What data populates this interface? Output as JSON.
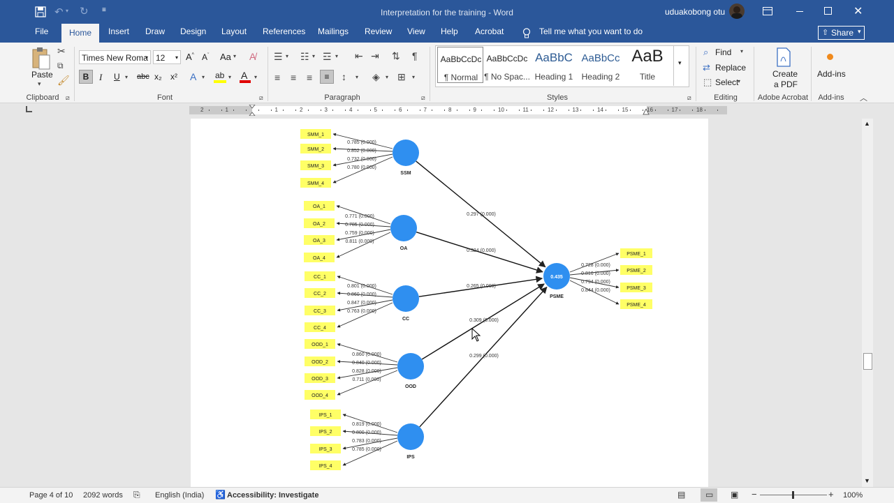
{
  "window": {
    "title": "Interpretation for the training",
    "app": "Word",
    "user": "uduakobong otu"
  },
  "tabs": [
    "File",
    "Home",
    "Insert",
    "Draw",
    "Design",
    "Layout",
    "References",
    "Mailings",
    "Review",
    "View",
    "Help",
    "Acrobat"
  ],
  "tell_me": "Tell me what you want to do",
  "share": "Share",
  "clipboard": {
    "paste": "Paste",
    "label": "Clipboard"
  },
  "font": {
    "name": "Times New Roma",
    "size": "12",
    "label": "Font",
    "bold": "B",
    "italic": "I",
    "underline": "U",
    "strike": "abc",
    "sub": "x₂",
    "sup": "x²",
    "aa": "Aa"
  },
  "paragraph": {
    "label": "Paragraph"
  },
  "styles": {
    "label": "Styles",
    "items": [
      {
        "preview": "AaBbCcDc",
        "name": "¶ Normal"
      },
      {
        "preview": "AaBbCcDc",
        "name": "¶ No Spac..."
      },
      {
        "preview": "AaBbC",
        "name": "Heading 1"
      },
      {
        "preview": "AaBbCc",
        "name": "Heading 2"
      },
      {
        "preview": "AaB",
        "name": "Title"
      }
    ]
  },
  "editing": {
    "label": "Editing",
    "find": "Find",
    "replace": "Replace",
    "select": "Select"
  },
  "acrobat": {
    "label": "Adobe Acrobat",
    "create": "Create",
    "pdf": "a PDF"
  },
  "addins": {
    "label": "Add-ins",
    "btn": "Add-ins"
  },
  "ruler": [
    "2",
    "1",
    "1",
    "2",
    "3",
    "4",
    "5",
    "6",
    "7",
    "8",
    "9",
    "10",
    "11",
    "12",
    "13",
    "14",
    "15",
    "16",
    "17",
    "18"
  ],
  "diagram": {
    "constructs": [
      {
        "name": "SSM",
        "value": ""
      },
      {
        "name": "OA",
        "value": ""
      },
      {
        "name": "CC",
        "value": ""
      },
      {
        "name": "OOD",
        "value": ""
      },
      {
        "name": "IPS",
        "value": ""
      },
      {
        "name": "PSME",
        "value": "0.435"
      }
    ],
    "indicators": [
      {
        "construct": "SSM",
        "items": [
          "SMM_1",
          "SMM_2",
          "SMM_3",
          "SMM_4"
        ],
        "loadings": [
          "0.785 (0.000)",
          "0.852 (0.000)",
          "0.732 (0.000)",
          "0.780 (0.000)"
        ]
      },
      {
        "construct": "OA",
        "items": [
          "OA_1",
          "OA_2",
          "OA_3",
          "OA_4"
        ],
        "loadings": [
          "0.771 (0.000)",
          "0.785 (0.000)",
          "0.759 (0.000)",
          "0.811 (0.000)"
        ]
      },
      {
        "construct": "CC",
        "items": [
          "CC_1",
          "CC_2",
          "CC_3",
          "CC_4"
        ],
        "loadings": [
          "0.801 (0.000)",
          "0.860 (0.000)",
          "0.847 (0.000)",
          "0.763 (0.000)"
        ]
      },
      {
        "construct": "OOD",
        "items": [
          "OOD_1",
          "OOD_2",
          "OOD_3",
          "OOD_4"
        ],
        "loadings": [
          "0.860 (0.000)",
          "0.840 (0.000)",
          "0.828 (0.000)",
          "0.711 (0.000)"
        ]
      },
      {
        "construct": "IPS",
        "items": [
          "IPS_1",
          "IPS_2",
          "IPS_3",
          "IPS_4"
        ],
        "loadings": [
          "0.819 (0.000)",
          "0.800 (0.000)",
          "0.783 (0.000)",
          "0.785 (0.000)"
        ]
      },
      {
        "construct": "PSME",
        "items": [
          "PSME_1",
          "PSME_2",
          "PSME_3",
          "PSME_4"
        ],
        "loadings": [
          "0.728 (0.000)",
          "0.816 (0.000)",
          "0.794 (0.000)",
          "0.844 (0.000)"
        ]
      }
    ],
    "paths": [
      {
        "from": "SSM",
        "to": "PSME",
        "coef": "0.297 (0.000)"
      },
      {
        "from": "OA",
        "to": "PSME",
        "coef": "0.324 (0.000)"
      },
      {
        "from": "CC",
        "to": "PSME",
        "coef": "0.265 (0.000)"
      },
      {
        "from": "OOD",
        "to": "PSME",
        "coef": "0.309 (0.000)"
      },
      {
        "from": "IPS",
        "to": "PSME",
        "coef": "0.299 (0.000)"
      }
    ],
    "colors": {
      "construct": "#2f8ff0",
      "indicator": "#ffff66"
    }
  },
  "status": {
    "page": "Page 4 of 10",
    "words": "2092 words",
    "language": "English (India)",
    "accessibility": "Accessibility: Investigate",
    "zoom": "100%"
  }
}
